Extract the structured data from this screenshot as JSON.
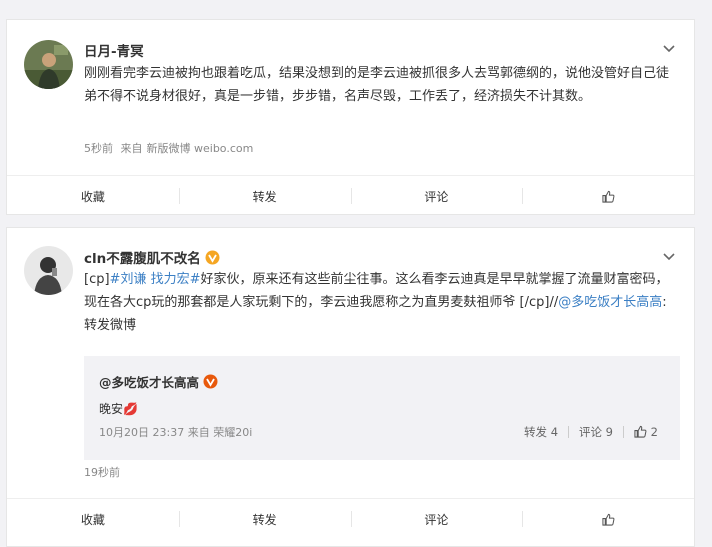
{
  "post1": {
    "username": "日月-青冥",
    "text": "刚刚看完李云迪被拘也跟着吃瓜，结果没想到的是李云迪被抓很多人去骂郭德纲的，说他没管好自己徒弟不得不说身材很好，真是一步错，步步错，名声尽毁，工作丢了，经济损失不计其数。",
    "time": "5秒前",
    "source_prefix": "来自",
    "source": "新版微博 weibo.com",
    "actions": {
      "favorite": "收藏",
      "repost": "转发",
      "comment": "评论"
    }
  },
  "post2": {
    "username": "cln不露腹肌不改名",
    "text_part1": "[cp]",
    "link1": "#刘谦 找力宏#",
    "text_part2": "好家伙，原来还有这些前尘往事。这么看李云迪真是早早就掌握了流量财富密码，现在各大cp玩的那套都是人家玩剩下的，李云迪我愿称之为直男麦麸祖师爷 [/cp]//",
    "link2": "@多吃饭才长高高",
    "text_part3": ":转发微博",
    "time": "19秒前",
    "repost": {
      "username": "@多吃饭才长高高",
      "text": "晚安💋",
      "time": "10月20日 23:37",
      "source_prefix": "来自",
      "source": "荣耀20i",
      "repost_label": "转发 4",
      "comment_label": "评论 9",
      "like_count": "2"
    },
    "actions": {
      "favorite": "收藏",
      "repost": "转发",
      "comment": "评论"
    }
  },
  "colors": {
    "link": "#3b7fc4",
    "badge": "#f5a623",
    "background": "#f2f2f5"
  }
}
